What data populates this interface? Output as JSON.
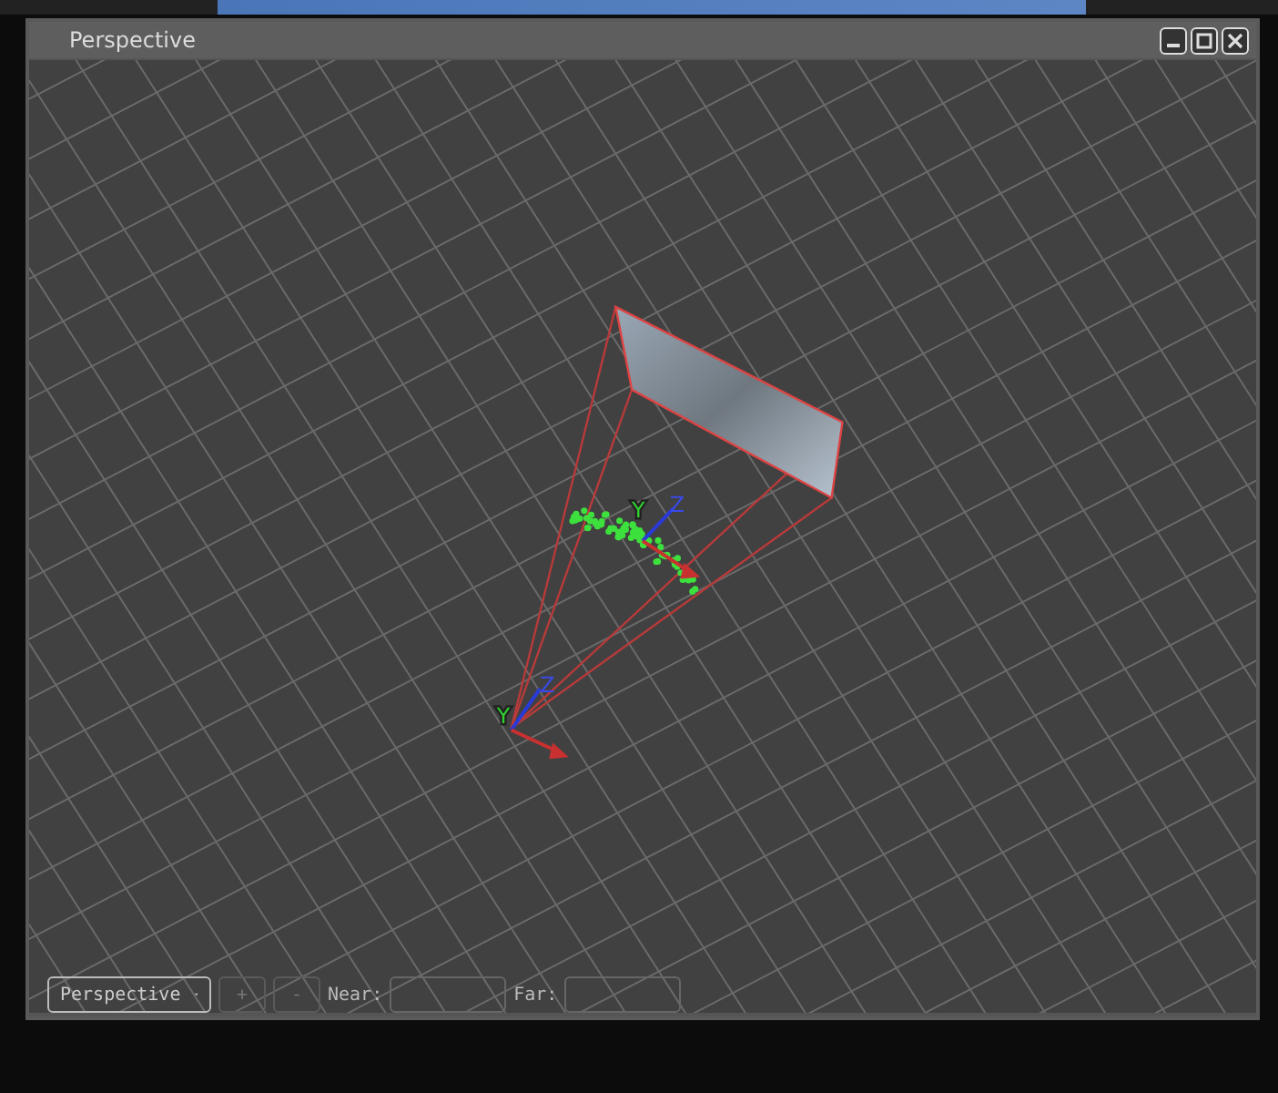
{
  "window": {
    "title": "Perspective",
    "buttons": [
      {
        "kind": "minimize"
      },
      {
        "kind": "maximize"
      },
      {
        "kind": "close"
      }
    ]
  },
  "viewport": {
    "gizmos": [
      {
        "z_label": "Z",
        "y_label": "Y"
      },
      {
        "z_label": "Z",
        "y_label": "Y"
      }
    ]
  },
  "toolbar": {
    "view_menu": "Perspective",
    "zoom_in": "+",
    "zoom_out": "-",
    "near_label": "Near:",
    "far_label": "Far:"
  }
}
